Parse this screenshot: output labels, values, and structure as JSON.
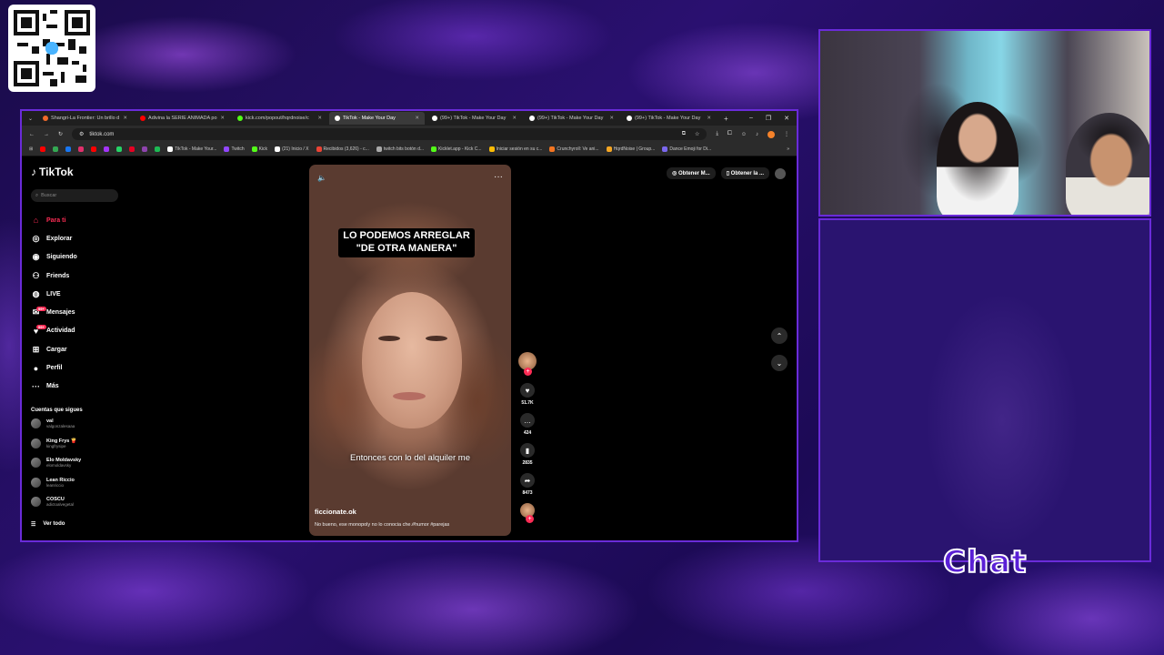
{
  "overlay": {
    "chat_label": "Chat"
  },
  "browser": {
    "tabs": [
      {
        "label": "Shangri-La Frontier: Un brillo d",
        "fav": "#f06a2b",
        "active": false
      },
      {
        "label": "Adivina la SERIE ANIMADA po",
        "fav": "#ff0000",
        "active": false
      },
      {
        "label": "kick.com/popout/hqrdnoise/c",
        "fav": "#53fc18",
        "active": false
      },
      {
        "label": "TikTok - Make Your Day",
        "fav": "#ffffff",
        "active": true
      },
      {
        "label": "(99+) TikTok - Make Your Day",
        "fav": "#ffffff",
        "active": false
      },
      {
        "label": "(99+) TikTok - Make Your Day",
        "fav": "#ffffff",
        "active": false
      },
      {
        "label": "(99+) TikTok - Make Your Day",
        "fav": "#ffffff",
        "active": false
      }
    ],
    "new_tab": "+",
    "url": "tiktok.com",
    "bookmarks": [
      {
        "label": "TikTok - Make Your...",
        "color": "#fff"
      },
      {
        "label": "Twitch",
        "color": "#9146ff"
      },
      {
        "label": "Kick",
        "color": "#53fc18"
      },
      {
        "label": "(21) Inicio / X",
        "color": "#fff"
      },
      {
        "label": "Recibidos (3,626) - c...",
        "color": "#ea4335"
      },
      {
        "label": "twitch bits botón d...",
        "color": "#aaa"
      },
      {
        "label": "Kicklet.app - Kick C...",
        "color": "#53fc18"
      },
      {
        "label": "Iniciar sesión en su c...",
        "color": "#fbbc05"
      },
      {
        "label": "Crunchyroll: Ve ani...",
        "color": "#f47521"
      },
      {
        "label": "HqrdNoise | Group...",
        "color": "#f5a623"
      },
      {
        "label": "Dance Emoji for Di...",
        "color": "#7b68ee"
      }
    ]
  },
  "tiktok": {
    "logo": "TikTok",
    "search_placeholder": "Buscar",
    "nav": [
      {
        "label": "Para ti",
        "icon": "home-icon",
        "glyph": "⌂",
        "active": true
      },
      {
        "label": "Explorar",
        "icon": "compass-icon",
        "glyph": "◎",
        "active": false
      },
      {
        "label": "Siguiendo",
        "icon": "following-icon",
        "glyph": "◉",
        "active": false
      },
      {
        "label": "Friends",
        "icon": "friends-icon",
        "glyph": "⚇",
        "active": false
      },
      {
        "label": "LIVE",
        "icon": "live-icon",
        "glyph": "◍",
        "active": false
      },
      {
        "label": "Mensajes",
        "icon": "messages-icon",
        "glyph": "✉",
        "active": false
      },
      {
        "label": "Actividad",
        "icon": "activity-icon",
        "glyph": "♥",
        "active": false
      },
      {
        "label": "Cargar",
        "icon": "upload-icon",
        "glyph": "⊞",
        "active": false
      },
      {
        "label": "Perfil",
        "icon": "profile-icon",
        "glyph": "●",
        "active": false
      },
      {
        "label": "Más",
        "icon": "more-icon",
        "glyph": "···",
        "active": false
      }
    ],
    "following_heading": "Cuentas que sigues",
    "following": [
      {
        "name": "val",
        "handle": "valgonzalesaaa"
      },
      {
        "name": "King Frys 🍟",
        "handle": "kingfrysipe"
      },
      {
        "name": "Elo Moldavsky",
        "handle": "elomoldavsky"
      },
      {
        "name": "Lean Riccio",
        "handle": "leanriccio"
      },
      {
        "name": "COSCU",
        "handle": "adictoalvegetal"
      }
    ],
    "see_all": "Ver todo",
    "top_buttons": [
      "Obtener M...",
      "Obtener la ..."
    ],
    "video": {
      "top_caption": "LO PODEMOS ARREGLAR \"DE OTRA MANERA\"",
      "subtitle": "Entonces con lo del alquiler me",
      "author": "ficcionate.ok",
      "description": "No bueno, ese monopoly no lo conocia che.#humor #parejas",
      "likes": "51.7K",
      "comments": "424",
      "saves": "2835",
      "shares": "8473"
    },
    "messages_badge": "99+"
  }
}
